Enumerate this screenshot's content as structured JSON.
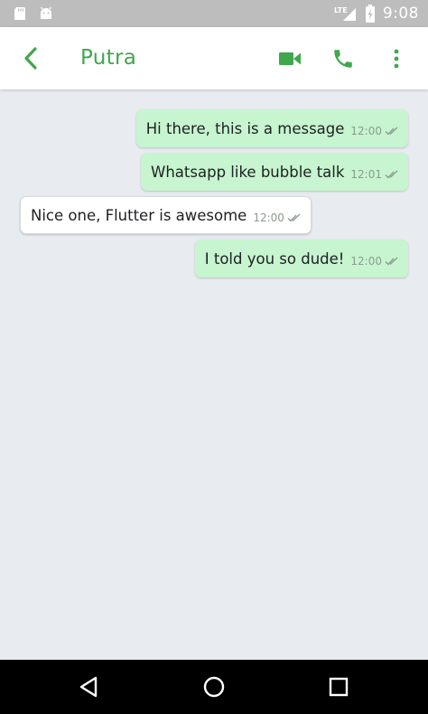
{
  "status_bar": {
    "time": "9:08",
    "network": "LTE",
    "icons": [
      "sd-card-icon",
      "android-icon",
      "signal-icon",
      "battery-charging-icon"
    ]
  },
  "app_bar": {
    "back_icon": "chevron-left-icon",
    "title": "Putra",
    "actions": [
      "video-call-icon",
      "phone-icon",
      "more-vert-icon"
    ]
  },
  "messages": [
    {
      "text": "Hi there, this is a message",
      "time": "12:00",
      "outgoing": true,
      "status": "double-check-icon"
    },
    {
      "text": "Whatsapp like bubble talk",
      "time": "12:01",
      "outgoing": true,
      "status": "double-check-icon"
    },
    {
      "text": "Nice one, Flutter is awesome",
      "time": "12:00",
      "outgoing": false,
      "status": "double-check-icon"
    },
    {
      "text": "I told you so dude!",
      "time": "12:00",
      "outgoing": true,
      "status": "double-check-icon"
    }
  ],
  "nav_bar": {
    "buttons": [
      "nav-back-icon",
      "nav-home-icon",
      "nav-recents-icon"
    ]
  },
  "colors": {
    "accent": "#3fa74e",
    "outgoing_bubble": "#c6f5cf",
    "incoming_bubble": "#ffffff",
    "chat_background": "#e8ebf0",
    "status_bar": "#bdbdbd",
    "nav_bar": "#000000"
  }
}
